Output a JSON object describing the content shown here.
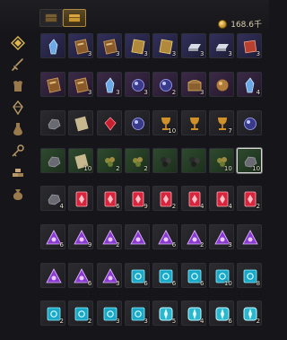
{
  "currency": {
    "amount": "168.6千",
    "icon": "gold-coin-icon"
  },
  "tabs": [
    {
      "icon": "storage-chest-icon",
      "active": false
    },
    {
      "icon": "storage-chest-icon",
      "active": true
    }
  ],
  "sidebar": [
    {
      "icon": "star-diamond-icon",
      "active": true
    },
    {
      "icon": "sword-icon",
      "active": false
    },
    {
      "icon": "armor-icon",
      "active": false
    },
    {
      "icon": "gem-icon",
      "active": false
    },
    {
      "icon": "potion-flask-icon",
      "active": false
    },
    {
      "icon": "key-icon",
      "active": false
    },
    {
      "icon": "gold-bars-icon",
      "active": false
    },
    {
      "icon": "pouch-icon",
      "active": false
    }
  ],
  "rows": [
    {
      "rarity": "blue",
      "items": [
        {
          "icon": "crystal-shard-icon",
          "count": ""
        },
        {
          "icon": "spellbook-icon",
          "count": "3"
        },
        {
          "icon": "spellbook-icon",
          "count": "3"
        },
        {
          "icon": "gold-tome-icon",
          "count": "3"
        },
        {
          "icon": "gold-tome-icon",
          "count": "3"
        },
        {
          "icon": "silver-ingot-icon",
          "count": "3"
        },
        {
          "icon": "silver-ingot-icon",
          "count": "3"
        },
        {
          "icon": "red-scroll-icon",
          "count": "3"
        }
      ]
    },
    {
      "rarity": "purple",
      "items": [
        {
          "icon": "recipe-book-icon",
          "count": ""
        },
        {
          "icon": "recipe-book-icon",
          "count": "3"
        },
        {
          "icon": "blue-crystal-icon",
          "count": "3"
        },
        {
          "icon": "dark-orb-icon",
          "count": "3"
        },
        {
          "icon": "purple-gem-icon",
          "count": "2"
        },
        {
          "icon": "treasure-chest-icon",
          "count": "3"
        },
        {
          "icon": "bronze-orb-icon",
          "count": ""
        },
        {
          "icon": "ice-shard-icon",
          "count": "4"
        }
      ]
    },
    {
      "rarity": "dark",
      "items": [
        {
          "icon": "ore-icon",
          "count": ""
        },
        {
          "icon": "feather-icon",
          "count": ""
        },
        {
          "icon": "ruby-icon",
          "count": ""
        },
        {
          "icon": "sapphire-icon",
          "count": ""
        },
        {
          "icon": "goblet-icon",
          "count": "10"
        },
        {
          "icon": "goblet-icon",
          "count": ""
        },
        {
          "icon": "goblet-icon",
          "count": "7"
        },
        {
          "icon": "arcane-gem-icon",
          "count": ""
        }
      ]
    },
    {
      "rarity": "green",
      "items": [
        {
          "icon": "stone-icon",
          "count": ""
        },
        {
          "icon": "parchment-icon",
          "count": "10"
        },
        {
          "icon": "herb-bundle-icon",
          "count": "2"
        },
        {
          "icon": "herb-bundle-icon",
          "count": "2"
        },
        {
          "icon": "coal-icon",
          "count": ""
        },
        {
          "icon": "coal-icon",
          "count": ""
        },
        {
          "icon": "seed-pouch-icon",
          "count": "10"
        },
        {
          "icon": "iron-ore-icon",
          "count": "10",
          "selected": true
        }
      ]
    },
    {
      "rarity": "grey",
      "items": [
        {
          "icon": "rock-fragment-icon",
          "count": "4"
        },
        {
          "icon": "red-rune-card-icon",
          "count": ""
        },
        {
          "icon": "red-rune-card-icon",
          "count": "6"
        },
        {
          "icon": "red-rune-card-icon",
          "count": "9"
        },
        {
          "icon": "red-rune-card-icon",
          "count": "2"
        },
        {
          "icon": "red-rune-card-icon",
          "count": "4"
        },
        {
          "icon": "red-rune-card-icon",
          "count": "4"
        },
        {
          "icon": "red-rune-card-icon",
          "count": "2"
        }
      ]
    },
    {
      "rarity": "grey",
      "items": [
        {
          "icon": "purple-rune-triangle-icon",
          "count": "6"
        },
        {
          "icon": "purple-rune-triangle-icon",
          "count": "9"
        },
        {
          "icon": "purple-rune-triangle-icon",
          "count": "2"
        },
        {
          "icon": "purple-rune-triangle-icon",
          "count": ""
        },
        {
          "icon": "purple-rune-triangle-icon",
          "count": "6"
        },
        {
          "icon": "purple-rune-triangle-icon",
          "count": "2"
        },
        {
          "icon": "purple-rune-triangle-icon",
          "count": "3"
        },
        {
          "icon": "purple-rune-triangle-icon",
          "count": ""
        }
      ]
    },
    {
      "rarity": "grey",
      "items": [
        {
          "icon": "purple-rune-triangle-icon",
          "count": ""
        },
        {
          "icon": "purple-rune-triangle-icon",
          "count": "6"
        },
        {
          "icon": "purple-rune-triangle-icon",
          "count": "3"
        },
        {
          "icon": "cyan-rune-square-icon",
          "count": "6"
        },
        {
          "icon": "cyan-rune-square-icon",
          "count": "6"
        },
        {
          "icon": "cyan-rune-square-icon",
          "count": "6"
        },
        {
          "icon": "cyan-rune-square-icon",
          "count": "10"
        },
        {
          "icon": "cyan-rune-square-icon",
          "count": "8"
        }
      ]
    },
    {
      "rarity": "grey",
      "items": [
        {
          "icon": "cyan-rune-square-icon",
          "count": "2"
        },
        {
          "icon": "cyan-rune-square-icon",
          "count": "2"
        },
        {
          "icon": "cyan-rune-square-icon",
          "count": "3"
        },
        {
          "icon": "cyan-rune-square-icon",
          "count": "3"
        },
        {
          "icon": "cyan-rune-ornate-icon",
          "count": "5"
        },
        {
          "icon": "cyan-rune-ornate-icon",
          "count": "4"
        },
        {
          "icon": "cyan-rune-ornate-icon",
          "count": "6"
        },
        {
          "icon": "cyan-rune-ornate-icon",
          "count": "2"
        }
      ]
    }
  ]
}
